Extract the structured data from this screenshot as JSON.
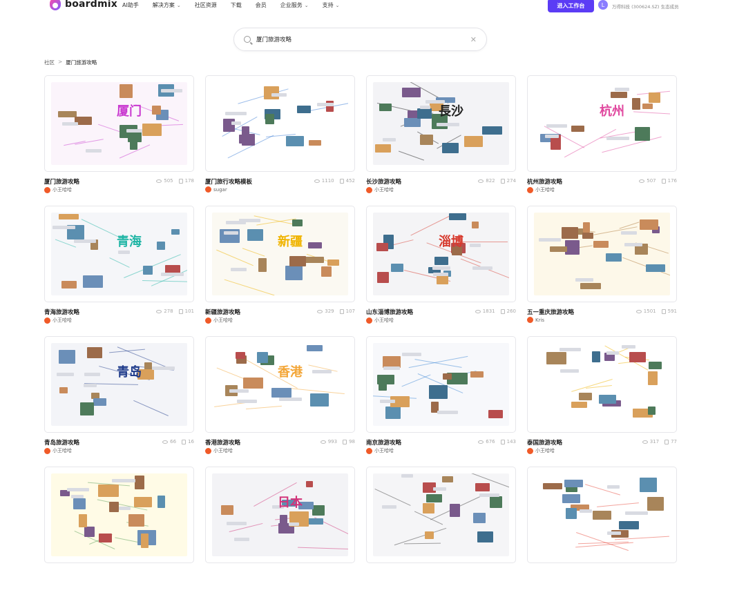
{
  "header": {
    "brand": "boardmix",
    "nav": [
      {
        "label": "AI助手",
        "has_menu": false
      },
      {
        "label": "解决方案",
        "has_menu": true
      },
      {
        "label": "社区资源",
        "has_menu": false
      },
      {
        "label": "下载",
        "has_menu": false
      },
      {
        "label": "会员",
        "has_menu": false
      },
      {
        "label": "企业服务",
        "has_menu": true
      },
      {
        "label": "支持",
        "has_menu": true
      }
    ],
    "cta_label": "进入工作台",
    "avatar_initial": "L",
    "company": "万得科技 (300624.SZ)  生态成员",
    "brand_color": "#5b3cf5"
  },
  "search": {
    "value": "厦门旅游攻略",
    "icon": "search-icon",
    "clear_icon": "close-icon"
  },
  "breadcrumb": {
    "root": "社区",
    "sep": ">",
    "current": "厦门旅游攻略"
  },
  "cards": [
    {
      "title": "厦门旅游攻略",
      "views": "505",
      "copies": "178",
      "author": "小王哈哈",
      "bg": "#fbf4fb",
      "accent": "#c93ad0",
      "big": "厦门"
    },
    {
      "title": "厦门旅行攻略模板",
      "views": "1110",
      "copies": "452",
      "author": "sugar",
      "bg": "#ffffff",
      "accent": "#3a7bd5",
      "big": ""
    },
    {
      "title": "长沙旅游攻略",
      "views": "822",
      "copies": "274",
      "author": "小王哈哈",
      "bg": "#f3f3f6",
      "accent": "#222222",
      "big": "長沙"
    },
    {
      "title": "杭州旅游攻略",
      "views": "507",
      "copies": "176",
      "author": "小王哈哈",
      "bg": "#ffffff",
      "accent": "#e0479e",
      "big": "杭州"
    },
    {
      "title": "青海旅游攻略",
      "views": "278",
      "copies": "101",
      "author": "小王哈哈",
      "bg": "#f5f6f9",
      "accent": "#1fb5a5",
      "big": "青海"
    },
    {
      "title": "新疆旅游攻略",
      "views": "329",
      "copies": "107",
      "author": "小王哈哈",
      "bg": "#fbf9f2",
      "accent": "#f0b400",
      "big": "新疆"
    },
    {
      "title": "山东淄博旅游攻略",
      "views": "1831",
      "copies": "260",
      "author": "小王哈哈",
      "bg": "#f4f4f6",
      "accent": "#d73a2e",
      "big": "淄博"
    },
    {
      "title": "五一重庆旅游攻略",
      "views": "1501",
      "copies": "591",
      "author": "Kris",
      "bg": "#fdf8e9",
      "accent": "#b07a3c",
      "big": ""
    },
    {
      "title": "青岛旅游攻略",
      "views": "66",
      "copies": "16",
      "author": "小王哈哈",
      "bg": "#f3f4f8",
      "accent": "#1e3a8a",
      "big": "青岛"
    },
    {
      "title": "香港旅游攻略",
      "views": "993",
      "copies": "98",
      "author": "小王哈哈",
      "bg": "#ffffff",
      "accent": "#f3a536",
      "big": "香港"
    },
    {
      "title": "南京旅游攻略",
      "views": "676",
      "copies": "143",
      "author": "小王哈哈",
      "bg": "#f7f8fb",
      "accent": "#3a86d6",
      "big": ""
    },
    {
      "title": "泰国旅游攻略",
      "views": "317",
      "copies": "77",
      "author": "小王哈哈",
      "bg": "#ffffff",
      "accent": "#f0b400",
      "big": ""
    },
    {
      "title": "",
      "views": "",
      "copies": "",
      "author": "",
      "bg": "#fffbe6",
      "accent": "#5aa05a",
      "big": ""
    },
    {
      "title": "",
      "views": "",
      "copies": "",
      "author": "",
      "bg": "#f3f3f6",
      "accent": "#d2337a",
      "big": "日本"
    },
    {
      "title": "",
      "views": "",
      "copies": "",
      "author": "",
      "bg": "#f5f5f7",
      "accent": "#444444",
      "big": ""
    },
    {
      "title": "",
      "views": "",
      "copies": "",
      "author": "",
      "bg": "#ffffff",
      "accent": "#e8483a",
      "big": ""
    }
  ]
}
